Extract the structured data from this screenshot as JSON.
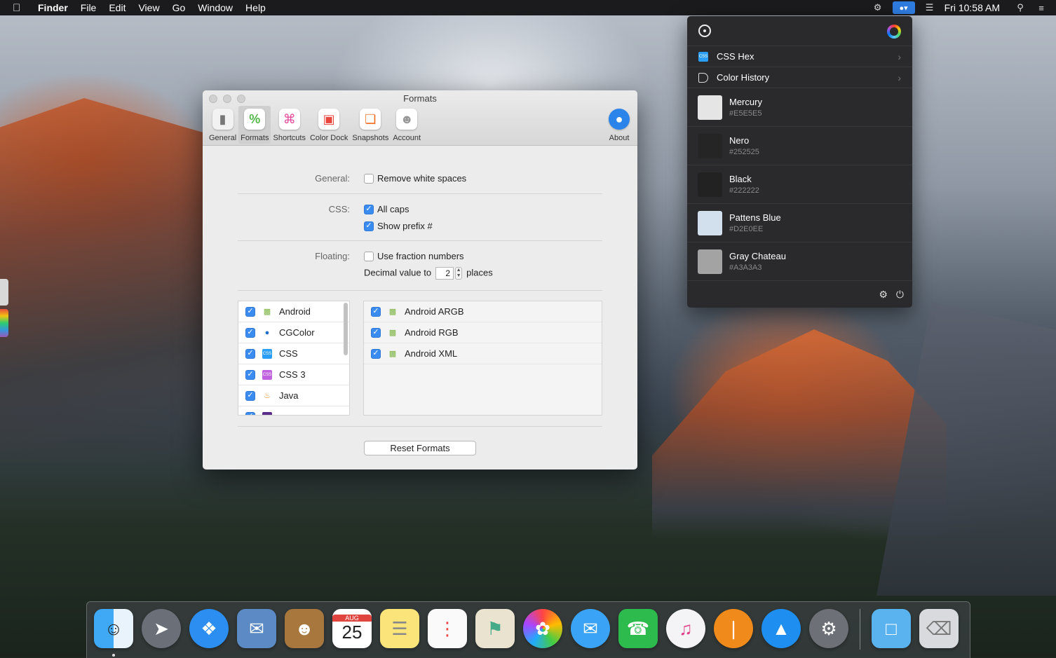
{
  "menubar": {
    "apple": "",
    "app_name": "Finder",
    "items": [
      "File",
      "Edit",
      "View",
      "Go",
      "Window",
      "Help"
    ],
    "clock": "Fri 10:58 AM"
  },
  "window": {
    "title": "Formats",
    "toolbar": [
      "General",
      "Formats",
      "Shortcuts",
      "Color Dock",
      "Snapshots",
      "Account"
    ],
    "about": "About",
    "general_label": "General:",
    "remove_white_spaces": "Remove white spaces",
    "css_label": "CSS:",
    "all_caps": "All caps",
    "show_prefix": "Show prefix #",
    "floating_label": "Floating:",
    "use_fraction": "Use fraction numbers",
    "decimal_label": "Decimal value to",
    "decimal_value": "2",
    "places": "places",
    "left_list": [
      "Android",
      "CGColor",
      "CSS",
      "CSS 3",
      "Java"
    ],
    "right_list": [
      "Android ARGB",
      "Android RGB",
      "Android XML"
    ],
    "reset": "Reset Formats"
  },
  "popover": {
    "css_hex": "CSS Hex",
    "css_badge": "CSS",
    "color_history": "Color History",
    "colors": [
      {
        "name": "Mercury",
        "hex": "#E5E5E5",
        "color": "#E5E5E5"
      },
      {
        "name": "Nero",
        "hex": "#252525",
        "color": "#252525"
      },
      {
        "name": "Black",
        "hex": "#222222",
        "color": "#222222"
      },
      {
        "name": "Pattens Blue",
        "hex": "#D2E0EE",
        "color": "#D2E0EE"
      },
      {
        "name": "Gray Chateau",
        "hex": "#A3A3A3",
        "color": "#A3A3A3"
      }
    ]
  },
  "dock": {
    "calendar_month": "AUG",
    "calendar_day": "25"
  }
}
